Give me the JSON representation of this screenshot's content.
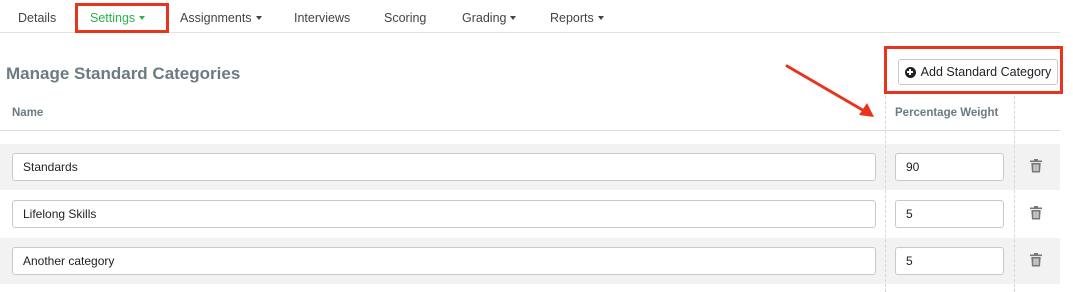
{
  "tabs": [
    {
      "label": "Details",
      "has_caret": false
    },
    {
      "label": "Settings",
      "has_caret": true,
      "active": true
    },
    {
      "label": "Assignments",
      "has_caret": true
    },
    {
      "label": "Interviews",
      "has_caret": false
    },
    {
      "label": "Scoring",
      "has_caret": false
    },
    {
      "label": "Grading",
      "has_caret": true
    },
    {
      "label": "Reports",
      "has_caret": true
    }
  ],
  "page": {
    "title": "Manage Standard Categories",
    "add_button_label": "Add Standard Category"
  },
  "table": {
    "columns": {
      "name": "Name",
      "weight": "Percentage Weight"
    },
    "rows": [
      {
        "name": "Standards",
        "weight": "90"
      },
      {
        "name": "Lifelong Skills",
        "weight": "5"
      },
      {
        "name": "Another category",
        "weight": "5"
      }
    ]
  },
  "colors": {
    "active_tab": "#2bb24c",
    "annotation": "#e8341c",
    "heading": "#6b7b83"
  },
  "icons": [
    "caret-down-icon",
    "plus-circle-icon",
    "trash-icon",
    "annotation-arrow"
  ]
}
